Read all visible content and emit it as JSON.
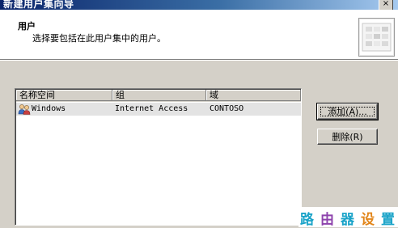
{
  "window": {
    "title": "新建用户集向导",
    "close_glyph": "×"
  },
  "header": {
    "title": "用户",
    "subtitle": "选择要包括在此用户集中的用户。"
  },
  "list": {
    "columns": [
      "名称空间",
      "组",
      "域"
    ],
    "rows": [
      {
        "namespace": "Windows",
        "group": "Internet Access",
        "domain": "CONTOSO",
        "icon": "users-group-icon"
      }
    ]
  },
  "buttons": {
    "add": "添加(A)...",
    "add_mnemonic": "A",
    "remove": "删除(R)",
    "remove_mnemonic": "R"
  },
  "watermark": {
    "chars": [
      "路",
      "由",
      "器",
      "设",
      "置"
    ],
    "colors": [
      "#1aa3c8",
      "#8e44ad",
      "#1aa3c8",
      "#e2861b",
      "#1aa3c8"
    ]
  }
}
